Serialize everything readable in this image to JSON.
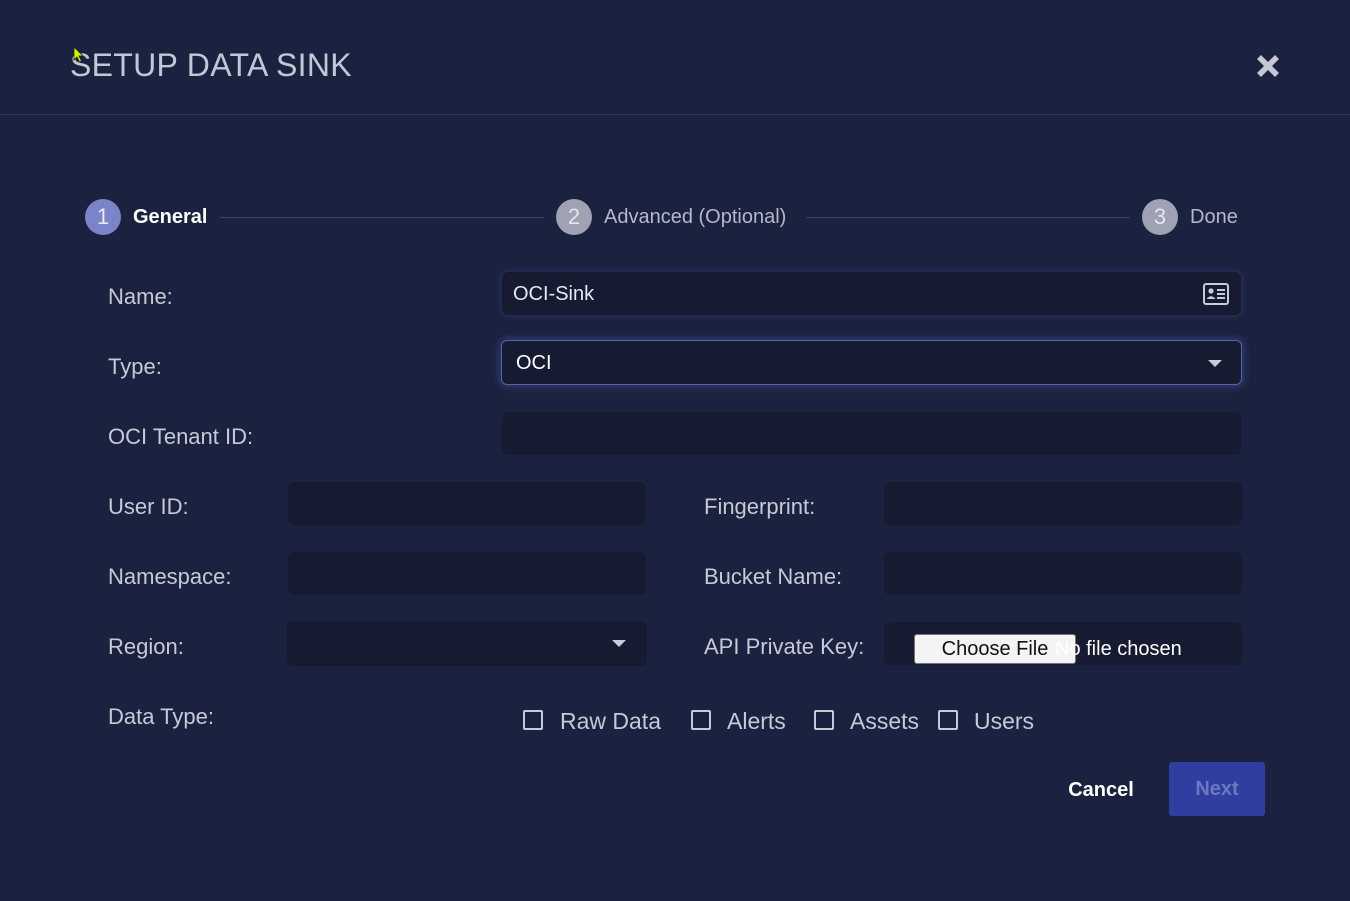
{
  "modal": {
    "title": "SETUP DATA SINK"
  },
  "stepper": {
    "steps": [
      {
        "number": "1",
        "label": "General",
        "state": "active"
      },
      {
        "number": "2",
        "label": "Advanced (Optional)",
        "state": "inactive"
      },
      {
        "number": "3",
        "label": "Done",
        "state": "inactive"
      }
    ]
  },
  "form": {
    "name": {
      "label": "Name:",
      "value": "OCI-Sink"
    },
    "type": {
      "label": "Type:",
      "value": "OCI"
    },
    "tenant_id": {
      "label": "OCI Tenant ID:",
      "value": ""
    },
    "user_id": {
      "label": "User ID:",
      "value": ""
    },
    "fingerprint": {
      "label": "Fingerprint:",
      "value": ""
    },
    "namespace": {
      "label": "Namespace:",
      "value": ""
    },
    "bucket_name": {
      "label": "Bucket Name:",
      "value": ""
    },
    "region": {
      "label": "Region:",
      "value": ""
    },
    "api_private_key": {
      "label": "API Private Key:",
      "button": "Choose File",
      "status": "No file chosen"
    },
    "data_type": {
      "label": "Data Type:",
      "options": [
        {
          "label": "Raw Data",
          "checked": false
        },
        {
          "label": "Alerts",
          "checked": false
        },
        {
          "label": "Assets",
          "checked": false
        },
        {
          "label": "Users",
          "checked": false
        }
      ]
    }
  },
  "actions": {
    "cancel": "Cancel",
    "next": "Next"
  },
  "colors": {
    "background": "#1b2240",
    "input_bg": "#161b31",
    "active_step": "#7a84c8",
    "next_button": "#2f3ea0"
  },
  "icons": {
    "close": "close-icon",
    "name_field": "contact-card-icon",
    "dropdown": "caret-down-icon"
  }
}
